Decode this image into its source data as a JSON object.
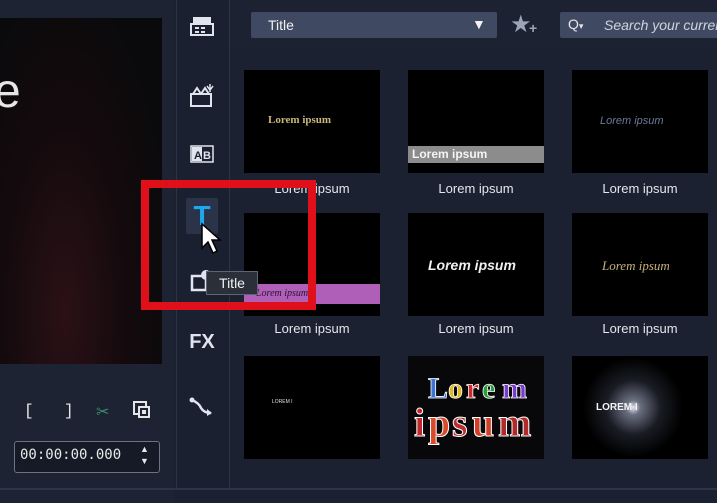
{
  "preview": {
    "glyph": "e"
  },
  "playback": {
    "mark_in": "[",
    "mark_out": "]",
    "timecode": "00:00:00.000",
    "spin": "▲▼"
  },
  "rail": {
    "fx_label": "FX",
    "text_icon_label": "T"
  },
  "toolbar": {
    "category": "Title",
    "search_placeholder": "Search your current library"
  },
  "tooltip": {
    "text": "Title"
  },
  "grid": {
    "items": [
      {
        "thumb_text": "Lorem ipsum",
        "caption": "Lorem ipsum"
      },
      {
        "thumb_text": "Lorem ipsum",
        "caption": "Lorem ipsum"
      },
      {
        "thumb_text": "Lorem ipsum",
        "caption": "Lorem ipsum"
      },
      {
        "thumb_text": "Lorem ipsum",
        "caption": "Lorem ipsum"
      },
      {
        "thumb_text": "Lorem ipsum",
        "caption": "Lorem ipsum"
      },
      {
        "thumb_text": "Lorem ipsum",
        "caption": "Lorem ipsum"
      },
      {
        "thumb_text": "LOREM I"
      },
      {
        "thumb_text": "Lorem ipsum"
      },
      {
        "thumb_text": "LOREM I"
      }
    ]
  },
  "colors": {
    "highlight": "#e0101a",
    "accent_blue": "#1ea7f0"
  }
}
